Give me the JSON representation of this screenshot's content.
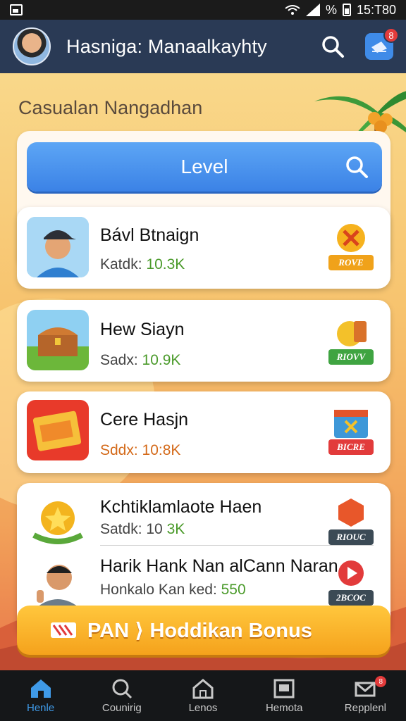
{
  "status_bar": {
    "percent": "%",
    "time": "15:T80"
  },
  "app_bar": {
    "title": "Hasniga: Manaalkayhty",
    "notification_count": "8"
  },
  "section": {
    "heading": "Casualan Nangadhan"
  },
  "level_button": {
    "label": "Level"
  },
  "cards": [
    {
      "title": "Bávl Btnaign",
      "sub_label": "Katdk:",
      "sub_value": "10.3K",
      "reward_tag": "ROVE"
    },
    {
      "title": "Hew Siayn",
      "sub_label": "Sadx:",
      "sub_value": "10.9K",
      "reward_tag": "RIOVV"
    },
    {
      "title": "Cere Hasjn",
      "sub_label": "Sddx:",
      "sub_value": "10:8K",
      "reward_tag": "BICRE"
    },
    {
      "title": "Kchtiklamlaote Haen",
      "sub_label": "Satdk: 10",
      "sub_value": "3K",
      "reward_tag": "RIOUC"
    },
    {
      "title": "Harik Hank Nan alCann Naran",
      "sub_label": "Honkalo Kan ked:",
      "sub_value": "550",
      "reward_tag": "2BCOC"
    }
  ],
  "bonus_button": {
    "label": "PAN ⟩ Hoddikan Bonus"
  },
  "bottom_nav": [
    {
      "label": "Henle",
      "icon": "home-icon",
      "active": true
    },
    {
      "label": "Counirig",
      "icon": "search-icon"
    },
    {
      "label": "Lenos",
      "icon": "house-icon"
    },
    {
      "label": "Hemota",
      "icon": "picture-icon"
    },
    {
      "label": "Repplenl",
      "icon": "mail-icon",
      "badge": "8"
    }
  ],
  "colors": {
    "accent": "#3f8be8",
    "app_bar": "#2a3a55",
    "bonus": "#f5a21c"
  }
}
